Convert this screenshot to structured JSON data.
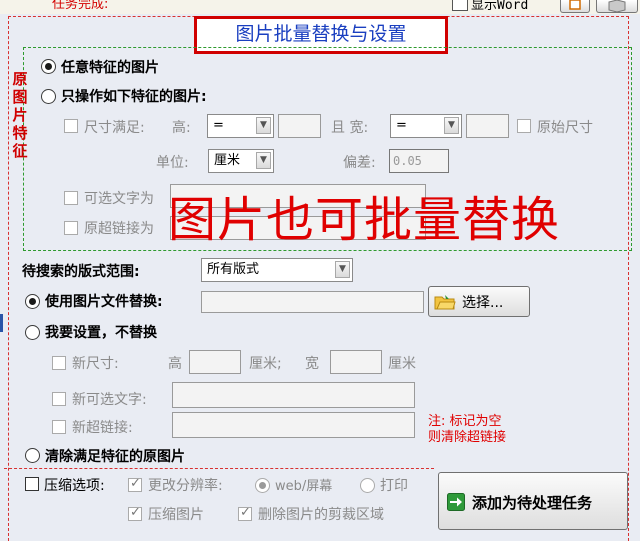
{
  "domain": "Computer-Use",
  "top": {
    "task_label": "任务完成:",
    "show_word_label": "显示Word"
  },
  "title": "图片批量替换与设置",
  "source_group": {
    "vertical_label": [
      "原",
      "图",
      "片",
      "特",
      "征"
    ],
    "any_feature_label": "任意特征的图片",
    "only_feature_label": "只操作如下特征的图片:",
    "size_check_label": "尺寸满足:",
    "height_label": "高:",
    "height_op": "=",
    "and_width_label": "且 宽:",
    "width_op": "=",
    "original_size_label": "原始尺寸",
    "unit_label": "单位:",
    "unit_value": "厘米",
    "tolerance_label": "偏差:",
    "tolerance_value": "0.05",
    "alt_text_label": "可选文字为",
    "hyperlink_label": "原超链接为"
  },
  "overlay_text": "图片也可批量替换",
  "layout_scope": {
    "label": "待搜索的版式范围:",
    "value": "所有版式"
  },
  "replace_with_file": {
    "label": "使用图片文件替换:",
    "file_value": "",
    "choose_button": "选择..."
  },
  "self_settings": {
    "label": "我要设置，不替换",
    "new_size_label": "新尺寸:",
    "height_label": "高",
    "cm_label_1": "厘米;",
    "width_label": "宽",
    "cm_label_2": "厘米",
    "new_alt_label": "新可选文字:",
    "new_link_label": "新超链接:",
    "note_line1": "注: 标记为空",
    "note_line2": "则清除超链接"
  },
  "clear_images": {
    "label": "清除满足特征的原图片"
  },
  "compress": {
    "label": "压缩选项:",
    "change_resolution_label": "更改分辨率:",
    "web_screen_label": "web/屏幕",
    "print_label": "打印",
    "compress_images_label": "压缩图片",
    "delete_crop_label": "删除图片的剪裁区域"
  },
  "add_task_button": "添加为待处理任务",
  "colors": {
    "accent_red": "#d00000",
    "title_blue": "#1a3fc0",
    "group_green": "#2e9a2e",
    "window_bg": "#e9ecf3"
  },
  "icons": [
    "folder-icon",
    "arrow-right-icon",
    "dropdown-arrow-icon",
    "window-icon",
    "cube-icon"
  ]
}
